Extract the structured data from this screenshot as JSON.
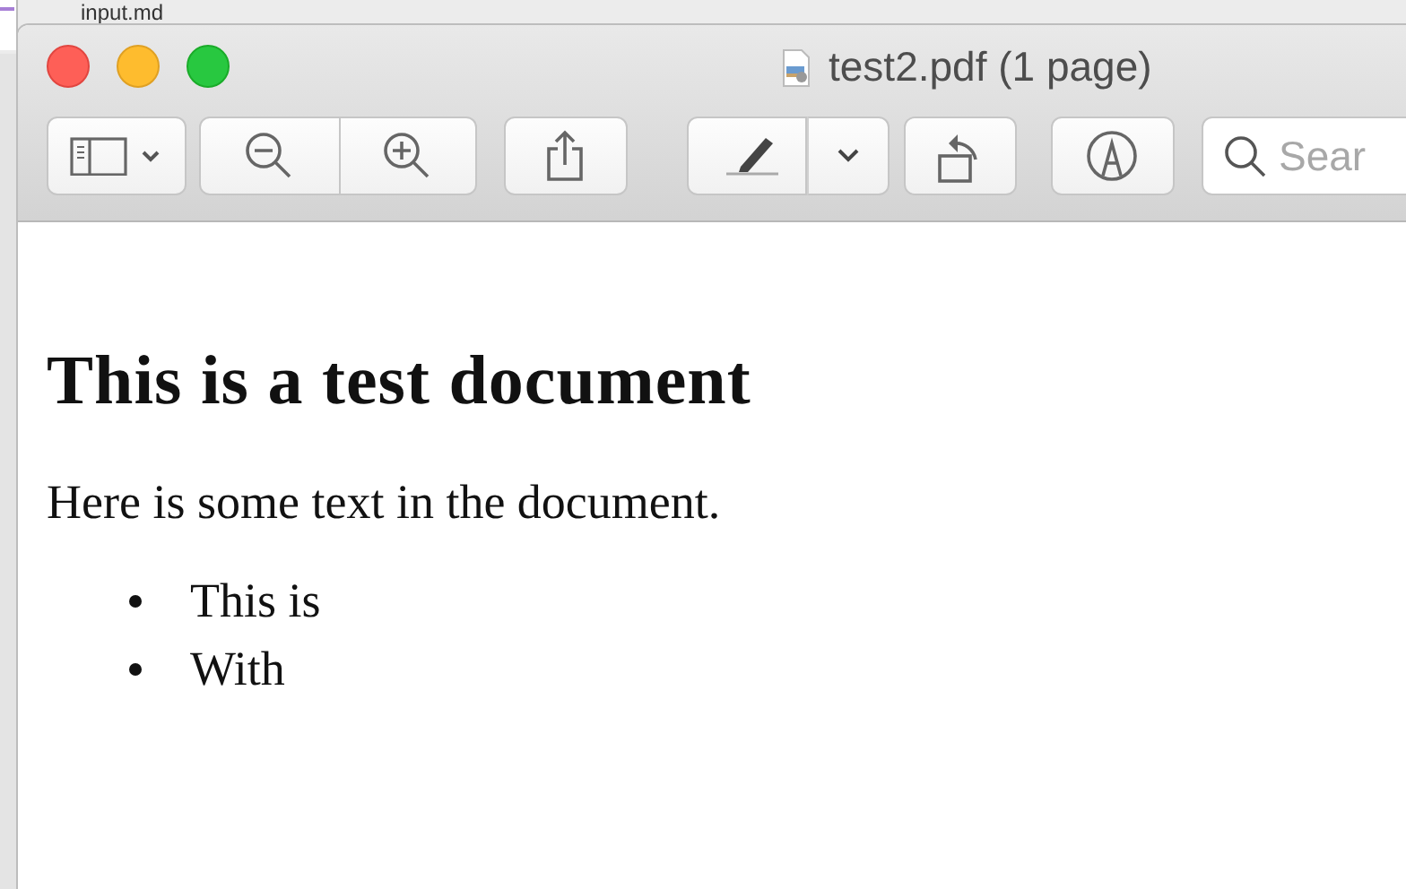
{
  "background_window": {
    "title": "input.md"
  },
  "window": {
    "title": "test2.pdf (1 page)"
  },
  "toolbar": {
    "search": {
      "placeholder": "Sear"
    }
  },
  "document": {
    "heading": "This is a test document",
    "paragraph": "Here is some text in the document.",
    "list": [
      "This is",
      "With"
    ]
  }
}
